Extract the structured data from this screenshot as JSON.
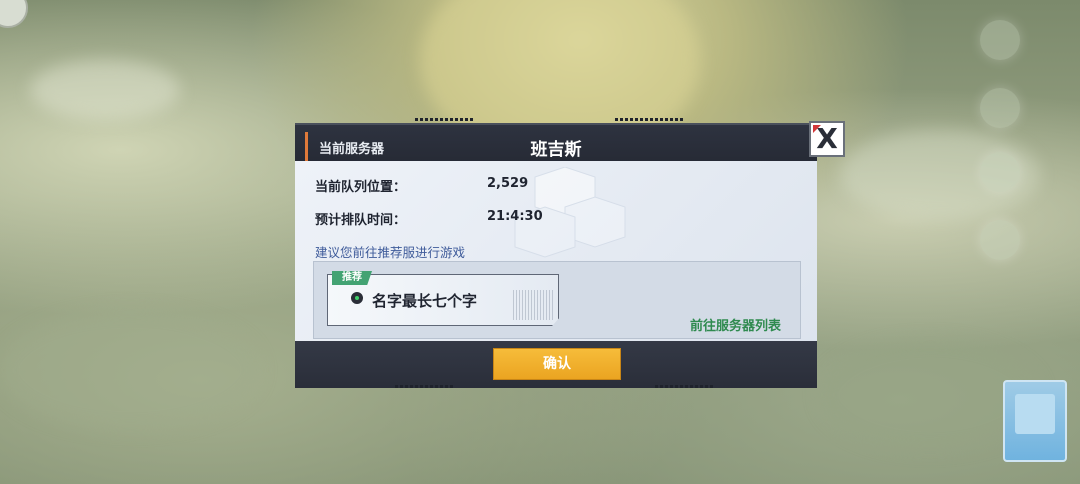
{
  "dialog": {
    "current_server_label": "当前服务器",
    "server_title": "班吉斯",
    "queue_position_label": "当前队列位置：",
    "queue_position_value": "2,529",
    "wait_time_label": "预计排队时间：",
    "wait_time_value": "21:4:30",
    "suggestion_text": "建议您前往推荐服进行游戏",
    "recommended": {
      "tag": "推荐",
      "server_name": "名字最长七个字",
      "status_color": "#3fd06a"
    },
    "goto_server_list": "前往服务器列表",
    "confirm_label": "确认",
    "close_glyph": "X"
  },
  "colors": {
    "accent_orange": "#e07a3a",
    "confirm_yellow": "#f2b02e",
    "link_green": "#2f8a4f",
    "suggest_blue": "#3e5b9a"
  }
}
